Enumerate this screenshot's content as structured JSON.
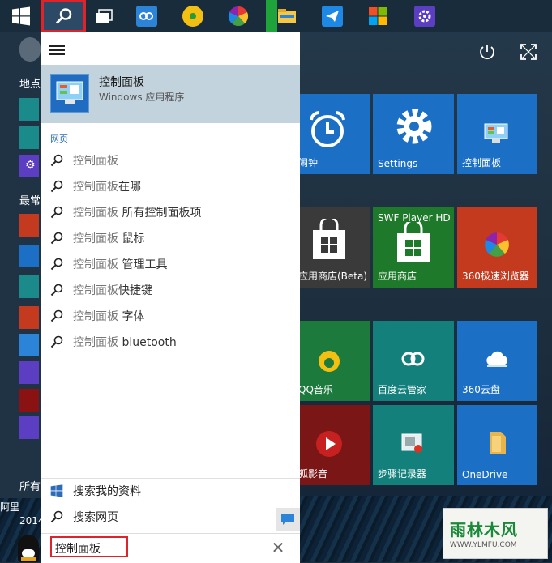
{
  "taskbar": {
    "start_label": "",
    "items": [
      "search",
      "task-view",
      "baidu-cloud",
      "qq-music",
      "360-browser",
      "file-explorer",
      "mail-app",
      "store",
      "settings"
    ]
  },
  "left_strip": {
    "places_label": "地点",
    "frequent_label": "最常",
    "all_label": "所有",
    "user_line1": "阿里",
    "user_line2": "2014"
  },
  "tiles": [
    {
      "label": "闹钟",
      "visible_label": "闹钟",
      "color": "#1b6fc5"
    },
    {
      "label": "Settings",
      "color": "#1b6fc5"
    },
    {
      "label": "控制面板",
      "color": "#1b6fc5"
    },
    {
      "label": "应用商店(Beta)",
      "visible_label": "应用商店(Beta)",
      "color": "#3a3a3a"
    },
    {
      "label": "应用商店",
      "sub": "SWF Player HD",
      "color": "#1e7a2a"
    },
    {
      "label": "360极速浏览器",
      "color": "#c33a1f"
    },
    {
      "label": "QQ音乐",
      "visible_label": "QQ音乐",
      "color": "#1c7a3c"
    },
    {
      "label": "百度云管家",
      "color": "#13807c"
    },
    {
      "label": "360云盘",
      "color": "#1b6fc5"
    },
    {
      "label": "猎狐影音",
      "visible_label": "狐影音",
      "color": "#7a1616"
    },
    {
      "label": "步骤记录器",
      "color": "#13807c"
    },
    {
      "label": "OneDrive",
      "color": "#1b6fc5"
    }
  ],
  "search": {
    "menu_icon": "hamburger-icon",
    "best_match": {
      "title": "控制面板",
      "subtitle": "Windows 应用程序"
    },
    "web_section": "网页",
    "suggestions": [
      {
        "prefix": "控制面板",
        "suffix": ""
      },
      {
        "prefix": "控制面板",
        "suffix": "在哪"
      },
      {
        "prefix": "控制面板",
        "suffix": " 所有控制面板项"
      },
      {
        "prefix": "控制面板",
        "suffix": " 鼠标"
      },
      {
        "prefix": "控制面板",
        "suffix": " 管理工具"
      },
      {
        "prefix": "控制面板",
        "suffix": "快捷键"
      },
      {
        "prefix": "控制面板",
        "suffix": " 字体"
      },
      {
        "prefix": "控制面板",
        "suffix": " bluetooth"
      }
    ],
    "my_stuff_label": "搜索我的资料",
    "web_label": "搜索网页",
    "input_value": "控制面板",
    "clear_glyph": "✕"
  },
  "watermark": {
    "title": "雨林木风",
    "url": "WWW.YLMFU.COM"
  },
  "colors": {
    "accent": "#e0232b",
    "panel": "#ffffff",
    "best_match_bg": "#c3d3de"
  }
}
